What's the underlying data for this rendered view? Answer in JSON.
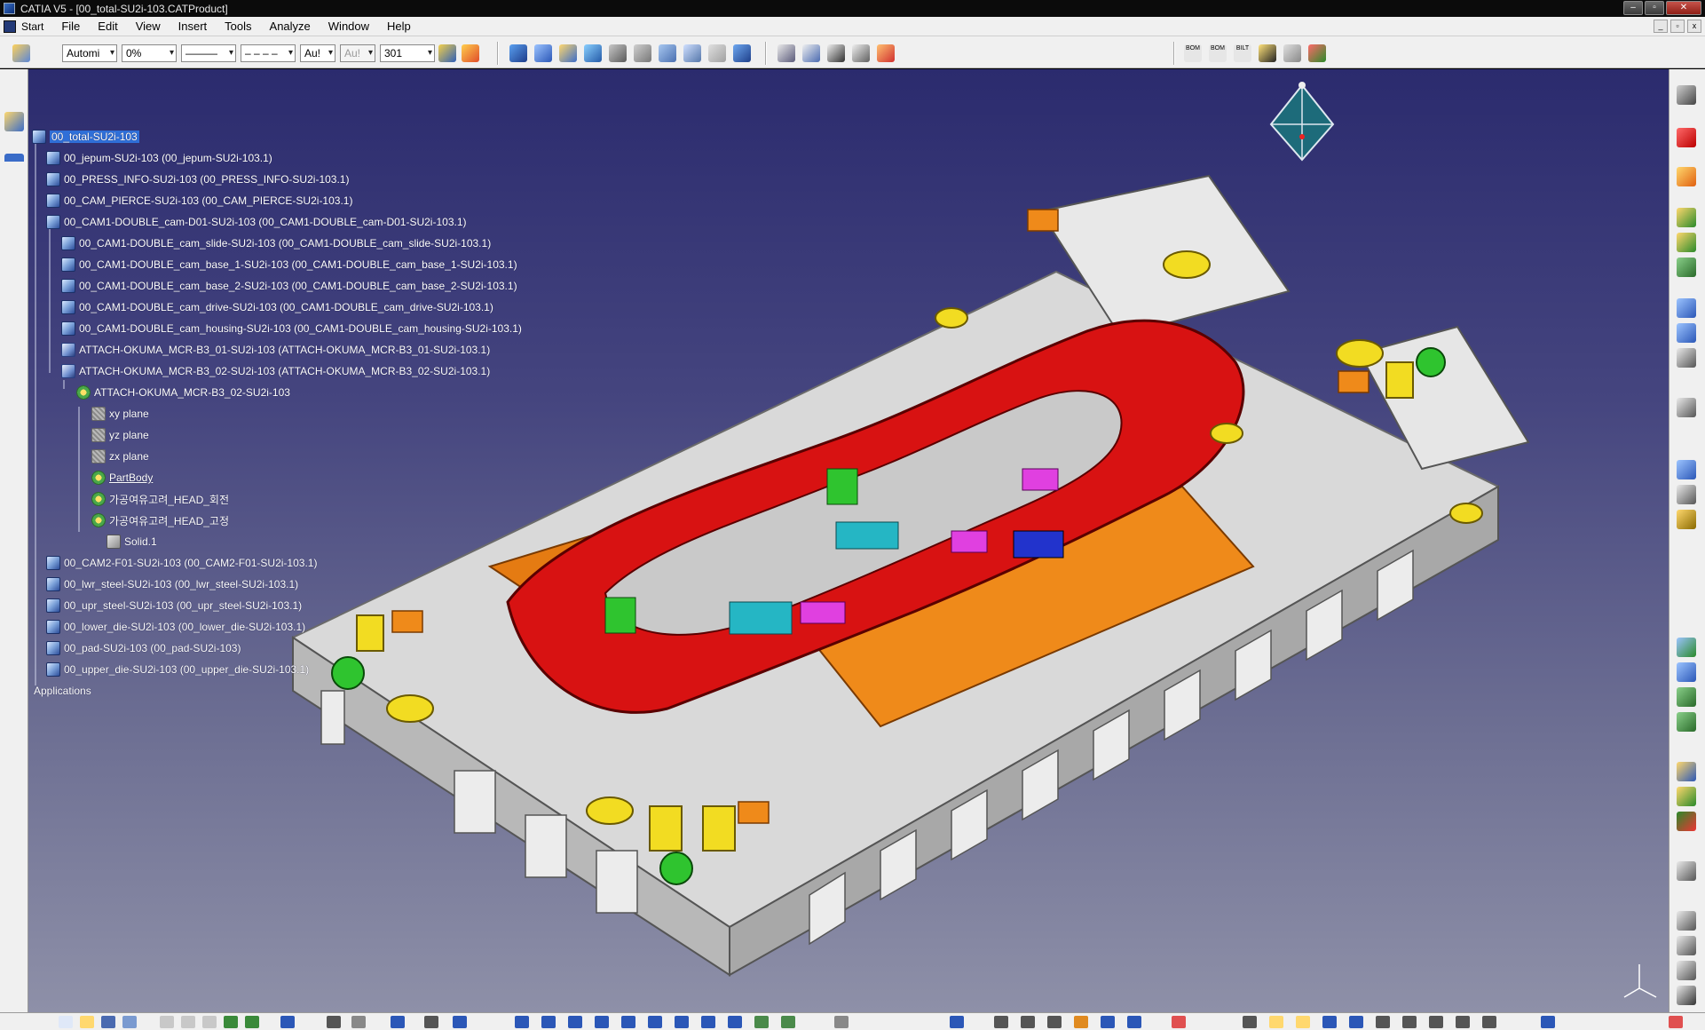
{
  "window": {
    "title": "CATIA V5 - [00_total-SU2i-103.CATProduct]",
    "buttons": [
      "–",
      "▫",
      "✕"
    ]
  },
  "menu": {
    "start": "Start",
    "items": [
      {
        "label": "File",
        "key": "F"
      },
      {
        "label": "Edit",
        "key": "E"
      },
      {
        "label": "View",
        "key": "V"
      },
      {
        "label": "Insert",
        "key": "I"
      },
      {
        "label": "Tools",
        "key": "T"
      },
      {
        "label": "Analyze",
        "key": "A"
      },
      {
        "label": "Window",
        "key": "W"
      },
      {
        "label": "Help",
        "key": "H"
      }
    ]
  },
  "toolbar": {
    "layer_value": "Automi",
    "transparency_value": "0%",
    "linetype_value": "———",
    "dash_value": "– – – –",
    "font_value": "Au!",
    "grey_value": "Au!",
    "lineweight_value": "301",
    "bom_labels": [
      "BOM",
      "BOM",
      "BILT"
    ]
  },
  "tree": {
    "root": "00_total-SU2i-103",
    "nodes": [
      {
        "label": "00_jepum-SU2i-103 (00_jepum-SU2i-103.1)",
        "type": "product",
        "level": 1
      },
      {
        "label": "00_PRESS_INFO-SU2i-103 (00_PRESS_INFO-SU2i-103.1)",
        "type": "product",
        "level": 1
      },
      {
        "label": "00_CAM_PIERCE-SU2i-103 (00_CAM_PIERCE-SU2i-103.1)",
        "type": "product",
        "level": 1
      },
      {
        "label": "00_CAM1-DOUBLE_cam-D01-SU2i-103 (00_CAM1-DOUBLE_cam-D01-SU2i-103.1)",
        "type": "product",
        "level": 1
      },
      {
        "label": "00_CAM1-DOUBLE_cam_slide-SU2i-103 (00_CAM1-DOUBLE_cam_slide-SU2i-103.1)",
        "type": "product",
        "level": 2
      },
      {
        "label": "00_CAM1-DOUBLE_cam_base_1-SU2i-103 (00_CAM1-DOUBLE_cam_base_1-SU2i-103.1)",
        "type": "product",
        "level": 2
      },
      {
        "label": "00_CAM1-DOUBLE_cam_base_2-SU2i-103 (00_CAM1-DOUBLE_cam_base_2-SU2i-103.1)",
        "type": "product",
        "level": 2
      },
      {
        "label": "00_CAM1-DOUBLE_cam_drive-SU2i-103 (00_CAM1-DOUBLE_cam_drive-SU2i-103.1)",
        "type": "product",
        "level": 2
      },
      {
        "label": "00_CAM1-DOUBLE_cam_housing-SU2i-103 (00_CAM1-DOUBLE_cam_housing-SU2i-103.1)",
        "type": "product",
        "level": 2
      },
      {
        "label": "ATTACH-OKUMA_MCR-B3_01-SU2i-103 (ATTACH-OKUMA_MCR-B3_01-SU2i-103.1)",
        "type": "part",
        "level": 2
      },
      {
        "label": "ATTACH-OKUMA_MCR-B3_02-SU2i-103 (ATTACH-OKUMA_MCR-B3_02-SU2i-103.1)",
        "type": "part",
        "level": 2
      },
      {
        "label": "ATTACH-OKUMA_MCR-B3_02-SU2i-103",
        "type": "gear",
        "level": 3
      },
      {
        "label": "xy plane",
        "type": "plane",
        "level": 4
      },
      {
        "label": "yz plane",
        "type": "plane",
        "level": 4
      },
      {
        "label": "zx plane",
        "type": "plane",
        "level": 4
      },
      {
        "label": "PartBody",
        "type": "gear",
        "level": 4,
        "underline": true
      },
      {
        "label": "가공여유고려_HEAD_회전",
        "type": "gear",
        "level": 4
      },
      {
        "label": "가공여유고려_HEAD_고정",
        "type": "gear",
        "level": 4
      },
      {
        "label": "Solid.1",
        "type": "solid",
        "level": 5
      },
      {
        "label": "00_CAM2-F01-SU2i-103 (00_CAM2-F01-SU2i-103.1)",
        "type": "product",
        "level": 1
      },
      {
        "label": "00_lwr_steel-SU2i-103 (00_lwr_steel-SU2i-103.1)",
        "type": "product",
        "level": 1
      },
      {
        "label": "00_upr_steel-SU2i-103 (00_upr_steel-SU2i-103.1)",
        "type": "product",
        "level": 1
      },
      {
        "label": "00_lower_die-SU2i-103 (00_lower_die-SU2i-103.1)",
        "type": "product",
        "level": 1
      },
      {
        "label": "00_pad-SU2i-103 (00_pad-SU2i-103)",
        "type": "product",
        "level": 1
      },
      {
        "label": "00_upper_die-SU2i-103 (00_upper_die-SU2i-103.1)",
        "type": "product",
        "level": 1
      }
    ],
    "applications": "Applications"
  },
  "colors": {
    "viewport_top": "#2b2b6e",
    "viewport_bottom": "#8e90a8",
    "part_red": "#d81212",
    "die_grey": "#d8d8d8",
    "cam_orange": "#e07a10",
    "highlight": "#2f6fd8"
  },
  "icons": {
    "compass": "compass-icon",
    "axis": "xyz-axis-icon"
  }
}
